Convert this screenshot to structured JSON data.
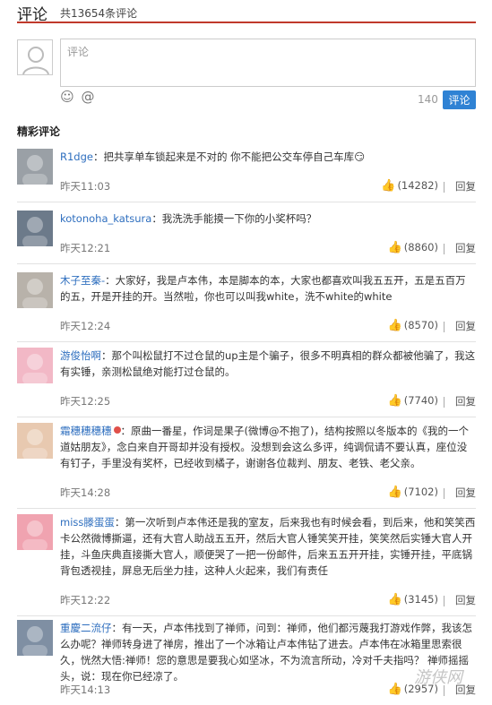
{
  "header": {
    "title": "评论",
    "count_text": "共13654条评论"
  },
  "composer": {
    "placeholder": "评论",
    "char_count": "140",
    "submit_label": "评论",
    "emoji_icon": "smiley-icon",
    "at_icon": "at-sign-icon"
  },
  "section": {
    "title": "精彩评论"
  },
  "comments": [
    {
      "user": "R1dge",
      "text": "：把共享单车锁起来是不对的 你不能把公交车停自己车库",
      "emoji": "😏",
      "time": "昨天11:03",
      "likes": "(14282)",
      "reply": "回复",
      "avatar_color": "#9aa0a6"
    },
    {
      "user": "kotonoha_katsura",
      "text": "：我洗洗手能摸一下你的小奖杯吗？",
      "time": "昨天12:21",
      "likes": "(8860)",
      "reply": "回复",
      "avatar_color": "#6c7a8a"
    },
    {
      "user": "木子至秦-",
      "text": "：大家好，我是卢本伟，本是脚本的本，大家也都喜欢叫我五五开，五是五百万的五，开是开挂的开。当然啦，你也可以叫我white，洗不white的white",
      "time": "昨天12:24",
      "likes": "(8570)",
      "reply": "回复",
      "avatar_color": "#b8b2aa"
    },
    {
      "user": "游俊怡啊",
      "text": "：那个叫松鼠打不过仓鼠的up主是个骗子，很多不明真相的群众都被他骗了，我这有实锤，亲测松鼠绝对能打过仓鼠的。",
      "time": "昨天12:25",
      "likes": "(7740)",
      "reply": "回复",
      "avatar_color": "#f2b8c6"
    },
    {
      "user": "霜穗穗穗穗",
      "flair": true,
      "text": "：原曲一番星，作词是果子(微博@不抱了)，结构按照以冬版本的《我的一个道姑朋友》，念白来自开哥却并没有授权。没想到会这么多评，纯调侃请不要认真，座位没有钉子，手里没有奖杯，已经收到橘子，谢谢各位裁判、朋友、老铁、老父亲。",
      "time": "昨天14:28",
      "likes": "(7102)",
      "reply": "回复",
      "avatar_color": "#e8c9b0"
    },
    {
      "user": "miss滕蛋蛋",
      "text": "：第一次听到卢本伟还是我的室友，后来我也有时候会看，到后来，他和笑笑西卡公然微博撕逼，还有大官人助战五五开，然后大官人锤笑笑开挂，笑笑然后实锤大官人开挂，斗鱼庆典直接撕大官人，顺便哭了一把一份邮件，后来五五开开挂，实锤开挂，平底锅背包透视挂，屏息无后坐力挂，这种人火起来，我们有责任",
      "time": "昨天12:22",
      "likes": "(3145)",
      "reply": "回复",
      "avatar_color": "#f0a3b0"
    },
    {
      "user": "重慶二流仔",
      "text": "：有一天，卢本伟找到了禅师，问到：禅师，他们都污蔑我打游戏作弊，我该怎么办呢？禅师转身进了禅房，推出了一个冰箱让卢本伟钻了进去。卢本伟在冰箱里思索很久，恍然大悟:禅师！您的意思是要我心如坚冰，不为流言所动，冷对千夫指吗？ 禅师摇摇头，说：现在你已经凉了。",
      "time": "昨天14:13",
      "likes": "(2957)",
      "reply": "回复",
      "avatar_color": "#7f8fa3"
    }
  ],
  "watermark": "游侠网"
}
